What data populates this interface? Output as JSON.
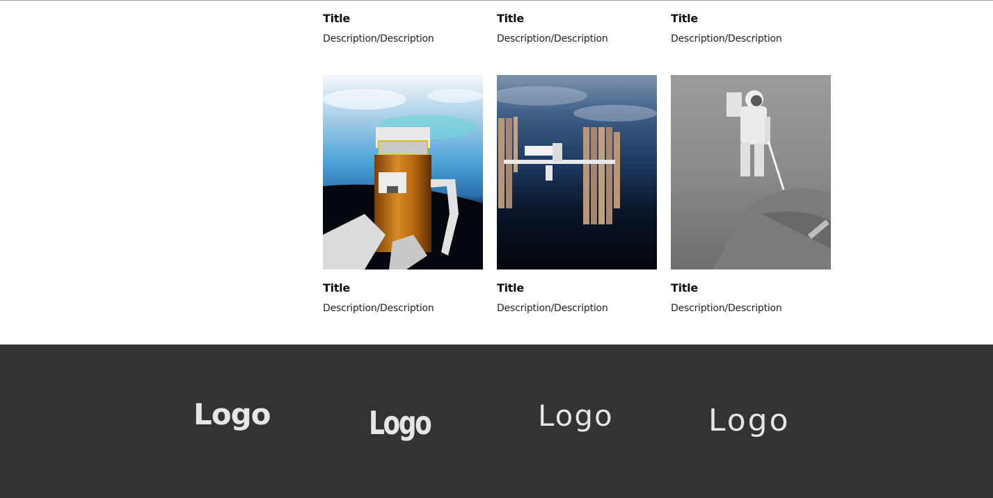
{
  "top_row": [
    {
      "title": "Title",
      "description": "Description/Description"
    },
    {
      "title": "Title",
      "description": "Description/Description"
    },
    {
      "title": "Title",
      "description": "Description/Description"
    }
  ],
  "gallery": [
    {
      "image": "spacecraft-over-earth-image",
      "title": "Title",
      "description": "Description/Description"
    },
    {
      "image": "space-station-image",
      "title": "Title",
      "description": "Description/Description"
    },
    {
      "image": "astronaut-on-moon-image",
      "title": "Title",
      "description": "Description/Description"
    }
  ],
  "footer": {
    "background": "#333333",
    "logos": [
      "Logo",
      "Logo",
      "Logo",
      "Logo"
    ]
  }
}
